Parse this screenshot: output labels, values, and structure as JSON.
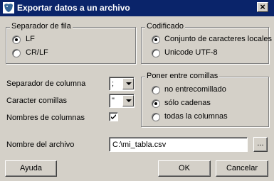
{
  "window": {
    "title": "Exportar datos a un archivo"
  },
  "row_separator": {
    "legend": "Separador de fila",
    "options": [
      {
        "label": "LF",
        "selected": true
      },
      {
        "label": "CR/LF",
        "selected": false
      }
    ]
  },
  "encoding": {
    "legend": "Codificado",
    "options": [
      {
        "label": "Conjunto de caracteres locales",
        "selected": true
      },
      {
        "label": "Unicode UTF-8",
        "selected": false
      }
    ]
  },
  "column_separator": {
    "label": "Separador de columna",
    "value": ";"
  },
  "quote_char": {
    "label": "Caracter comillas",
    "value": "\""
  },
  "column_names": {
    "label": "Nombres de columnas",
    "checked": true
  },
  "quoting": {
    "legend": "Poner entre comillas",
    "options": [
      {
        "label": "no entrecomillado",
        "selected": false
      },
      {
        "label": "sólo cadenas",
        "selected": true
      },
      {
        "label": "todas la columnas",
        "selected": false
      }
    ]
  },
  "filename": {
    "label": "Nombre del archivo",
    "value": "C:\\mi_tabla.csv",
    "browse_label": "..."
  },
  "buttons": {
    "help": "Ayuda",
    "ok": "OK",
    "cancel": "Cancelar"
  }
}
